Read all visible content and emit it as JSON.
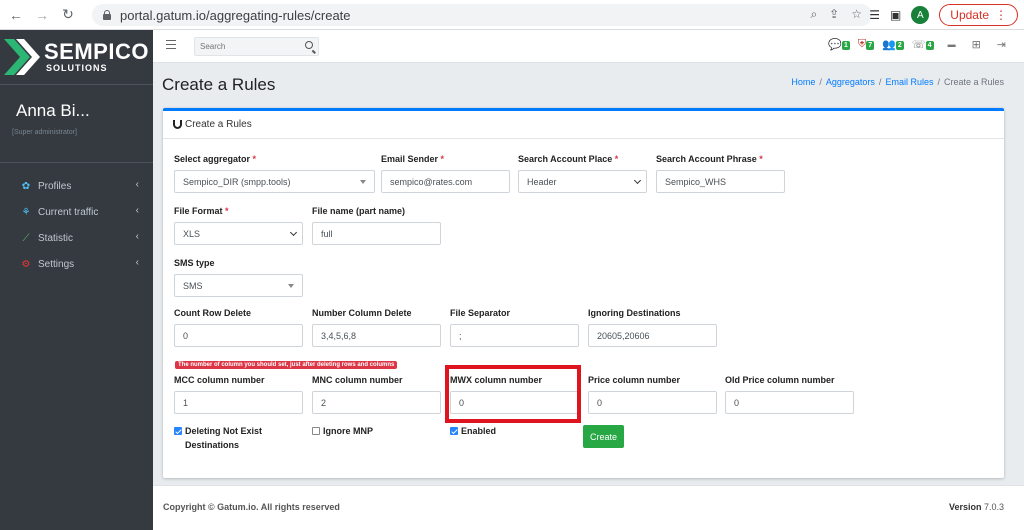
{
  "browser": {
    "url": "portal.gatum.io/aggregating-rules/create",
    "update_label": "Update",
    "avatar_initial": "A"
  },
  "sidebar": {
    "logo_big": "SEMPICO",
    "logo_small": "SOLUTIONS",
    "user_name": "Anna Bi...",
    "user_role": "[Super administrator]",
    "items": [
      {
        "label": "Profiles",
        "icon": "profiles-icon",
        "color": "#4fc3f7"
      },
      {
        "label": "Current traffic",
        "icon": "traffic-icon",
        "color": "#4fc3f7"
      },
      {
        "label": "Statistic",
        "icon": "chart-icon",
        "color": "#66bb6a"
      },
      {
        "label": "Settings",
        "icon": "settings-icon",
        "color": "#e53935"
      }
    ]
  },
  "topnav": {
    "search_placeholder": "Search",
    "badges": [
      "1",
      "7",
      "2",
      "4"
    ]
  },
  "page": {
    "title": "Create a Rules",
    "breadcrumb": [
      "Home",
      "Aggregators",
      "Email Rules",
      "Create a Rules"
    ]
  },
  "card": {
    "title": "Create a Rules"
  },
  "form": {
    "aggregator": {
      "label": "Select aggregator",
      "value": "Sempico_DIR (smpp.tools)"
    },
    "email_sender": {
      "label": "Email Sender",
      "value": "sempico@rates.com"
    },
    "search_place": {
      "label": "Search Account Place",
      "value": "Header"
    },
    "search_phrase": {
      "label": "Search Account Phrase",
      "value": "Sempico_WHS"
    },
    "file_format": {
      "label": "File Format",
      "value": "XLS"
    },
    "file_name": {
      "label": "File name (part name)",
      "value": "full"
    },
    "sms_type": {
      "label": "SMS type",
      "value": "SMS"
    },
    "count_row_delete": {
      "label": "Count Row Delete",
      "value": "0"
    },
    "number_column_delete": {
      "label": "Number Column Delete",
      "value": "3,4,5,6,8"
    },
    "file_separator": {
      "label": "File Separator",
      "value": ";"
    },
    "ignoring_destinations": {
      "label": "Ignoring Destinations",
      "value": "20605,20606"
    },
    "hint": "The number of column you should set, just after deleting rows and columns",
    "mcc": {
      "label": "MCC column number",
      "value": "1"
    },
    "mnc": {
      "label": "MNC column number",
      "value": "2"
    },
    "mwx": {
      "label": "MWX column number",
      "value": "0"
    },
    "price": {
      "label": "Price column number",
      "value": "0"
    },
    "old_price": {
      "label": "Old Price column number",
      "value": "0"
    },
    "deleting_not_exist_1": "Deleting Not Exist",
    "deleting_not_exist_2": "Destinations",
    "ignore_mnp": "Ignore MNP",
    "enabled": "Enabled",
    "create_label": "Create"
  },
  "footer": {
    "copyright": "Copyright © Gatum.io. All rights reserved",
    "version_label": "Version",
    "version": "7.0.3"
  }
}
